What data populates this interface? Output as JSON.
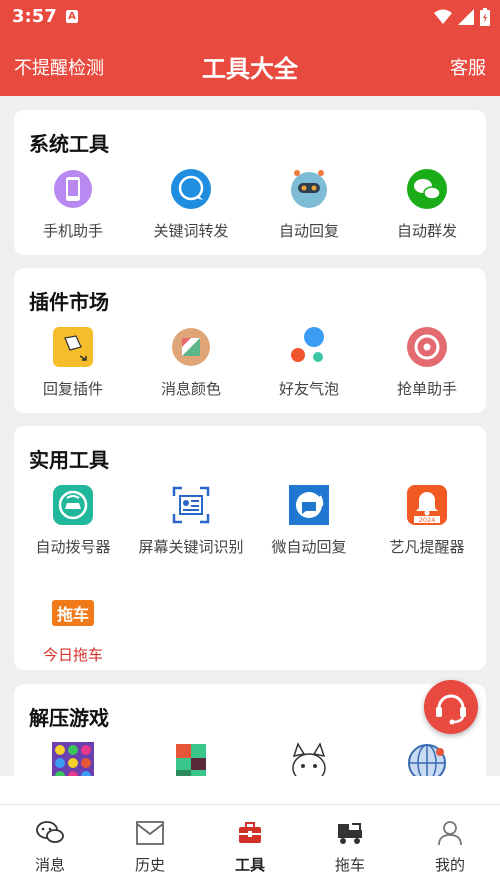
{
  "status": {
    "time": "3:57",
    "indicator": "A"
  },
  "header": {
    "left": "不提醒检测",
    "title": "工具大全",
    "right": "客服"
  },
  "sections": [
    {
      "title": "系统工具",
      "items": [
        {
          "label": "手机助手",
          "icon": "phone-icon"
        },
        {
          "label": "关键词转发",
          "icon": "chat-bubble-icon"
        },
        {
          "label": "自动回复",
          "icon": "robot-icon"
        },
        {
          "label": "自动群发",
          "icon": "wechat-icon"
        }
      ]
    },
    {
      "title": "插件市场",
      "items": [
        {
          "label": "回复插件",
          "icon": "plugin-icon"
        },
        {
          "label": "消息颜色",
          "icon": "palette-icon"
        },
        {
          "label": "好友气泡",
          "icon": "bubbles-icon"
        },
        {
          "label": "抢单助手",
          "icon": "target-icon"
        }
      ]
    },
    {
      "title": "实用工具",
      "items": [
        {
          "label": "自动拨号器",
          "icon": "car-dial-icon"
        },
        {
          "label": "屏幕关键词识别",
          "icon": "scan-icon"
        },
        {
          "label": "微自动回复",
          "icon": "auto-reply-icon"
        },
        {
          "label": "艺凡提醒器",
          "icon": "bell-icon",
          "badge": "2024"
        },
        {
          "label": "今日拖车",
          "icon": "tow-icon",
          "badge": "拖车",
          "highlight": true
        }
      ]
    },
    {
      "title": "解压游戏",
      "items": [
        {
          "label": "",
          "icon": "gem-game-icon"
        },
        {
          "label": "",
          "icon": "block-game-icon"
        },
        {
          "label": "",
          "icon": "cat-game-icon"
        },
        {
          "label": "",
          "icon": "globe-game-icon"
        }
      ]
    }
  ],
  "tabs": [
    {
      "label": "消息",
      "icon": "messages-icon"
    },
    {
      "label": "历史",
      "icon": "history-icon"
    },
    {
      "label": "工具",
      "icon": "toolbox-icon",
      "active": true
    },
    {
      "label": "拖车",
      "icon": "tow-truck-icon"
    },
    {
      "label": "我的",
      "icon": "profile-icon"
    }
  ],
  "colors": {
    "brand": "#e94a3f",
    "highlight_text": "#d2302b"
  }
}
